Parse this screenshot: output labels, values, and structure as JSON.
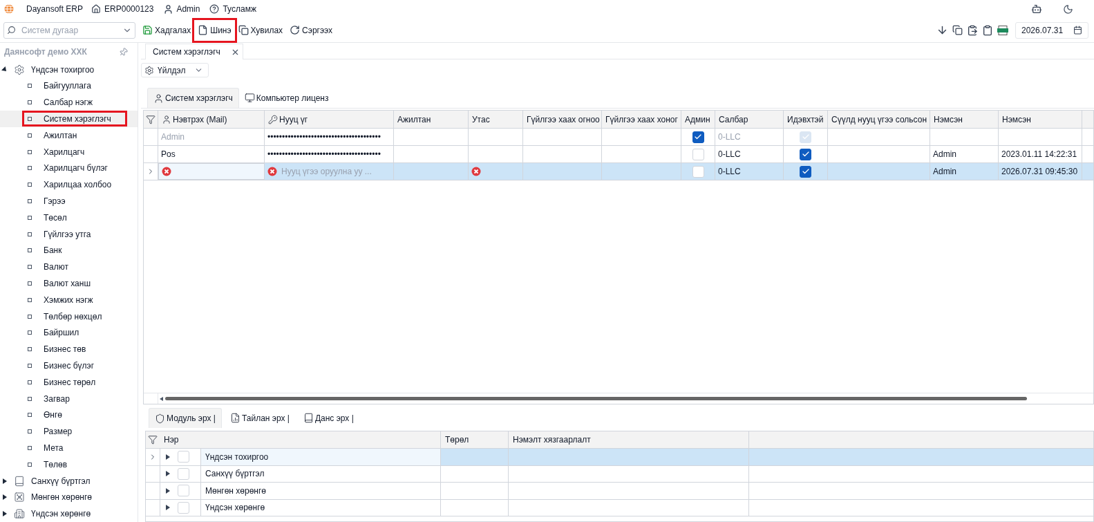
{
  "topbar": {
    "app": "Dayansoft ERP",
    "document": "ERP0000123",
    "user": "Admin",
    "help": "Тусламж"
  },
  "toolbar": {
    "search_placeholder": "Систем дугаар",
    "buttons": [
      {
        "kind": "save",
        "label": "Хадгалах",
        "highlighted": false
      },
      {
        "kind": "new",
        "label": "Шинэ",
        "highlighted": true
      },
      {
        "kind": "copy",
        "label": "Хувилах",
        "highlighted": false
      },
      {
        "kind": "refresh",
        "label": "Сэргээх",
        "highlighted": false
      }
    ],
    "date": "2026.07.31"
  },
  "sidebar": {
    "company": "Даянсофт демо ХХК",
    "items": [
      {
        "kind": "settings",
        "label": "Үндсэн тохиргоо",
        "expanded": true,
        "children": [
          {
            "label": "Байгууллага",
            "selected": false,
            "highlighted": false
          },
          {
            "label": "Салбар нэгж",
            "selected": false,
            "highlighted": false
          },
          {
            "label": "Систем хэрэглэгч",
            "selected": true,
            "highlighted": true
          },
          {
            "label": "Ажилтан",
            "selected": false,
            "highlighted": false
          },
          {
            "label": "Харилцагч",
            "selected": false,
            "highlighted": false
          },
          {
            "label": "Харилцагч бүлэг",
            "selected": false,
            "highlighted": false
          },
          {
            "label": "Харилцаа холбоо",
            "selected": false,
            "highlighted": false
          },
          {
            "label": "Гэрээ",
            "selected": false,
            "highlighted": false
          },
          {
            "label": "Төсөл",
            "selected": false,
            "highlighted": false
          },
          {
            "label": "Гүйлгээ утга",
            "selected": false,
            "highlighted": false
          },
          {
            "label": "Банк",
            "selected": false,
            "highlighted": false
          },
          {
            "label": "Валют",
            "selected": false,
            "highlighted": false
          },
          {
            "label": "Валют ханш",
            "selected": false,
            "highlighted": false
          },
          {
            "label": "Хэмжих нэгж",
            "selected": false,
            "highlighted": false
          },
          {
            "label": "Төлбөр нөхцөл",
            "selected": false,
            "highlighted": false
          },
          {
            "label": "Байршил",
            "selected": false,
            "highlighted": false
          },
          {
            "label": "Бизнес төв",
            "selected": false,
            "highlighted": false
          },
          {
            "label": "Бизнес бүлэг",
            "selected": false,
            "highlighted": false
          },
          {
            "label": "Бизнес төрөл",
            "selected": false,
            "highlighted": false
          },
          {
            "label": "Загвар",
            "selected": false,
            "highlighted": false
          },
          {
            "label": "Өнгө",
            "selected": false,
            "highlighted": false
          },
          {
            "label": "Размер",
            "selected": false,
            "highlighted": false
          },
          {
            "label": "Мета",
            "selected": false,
            "highlighted": false
          },
          {
            "label": "Төлөв",
            "selected": false,
            "highlighted": false
          }
        ]
      },
      {
        "kind": "book",
        "label": "Санхүү бүртгэл",
        "expanded": false
      },
      {
        "kind": "safe",
        "label": "Мөнгөн хөрөнгө",
        "expanded": false
      },
      {
        "kind": "building",
        "label": "Үндсэн хөрөнгө",
        "expanded": false
      }
    ]
  },
  "document_tab": "Систем хэрэглэгч",
  "action_button": "Үйлдэл",
  "tabs": [
    {
      "kind": "user",
      "label": "Систем хэрэглэгч",
      "selected": true
    },
    {
      "kind": "computer",
      "label": "Компьютер лиценз",
      "selected": false
    }
  ],
  "table": {
    "columns": [
      {
        "label": "Нэвтрэх (Mail)",
        "kind": "user"
      },
      {
        "label": "Нууц үг",
        "kind": "key"
      },
      {
        "label": "Ажилтан"
      },
      {
        "label": "Утас"
      },
      {
        "label": "Гүйлгээ хаах огноо"
      },
      {
        "label": "Гүйлгээ хаах хоног"
      },
      {
        "label": "Админ"
      },
      {
        "label": "Салбар"
      },
      {
        "label": "Идэвхтэй"
      },
      {
        "label": "Сүүлд нууц үгээ сольсон"
      },
      {
        "label": "Нэмсэн"
      },
      {
        "label": "Нэмсэн"
      }
    ],
    "rows": [
      {
        "selected": false,
        "disabled": true,
        "login": "Admin",
        "password": "•••••••••••••••••••••••••••••••••••••••",
        "admin": true,
        "branch": "0-LLC",
        "active": true
      },
      {
        "selected": false,
        "disabled": false,
        "login": "Pos",
        "password": "•••••••••••••••••••••••••••••••••••••••",
        "admin": false,
        "branch": "0-LLC",
        "active": true,
        "added_by": "Admin",
        "added_at": "2023.01.11 14:22:31"
      },
      {
        "selected": true,
        "disabled": false,
        "login_error": true,
        "password_error": true,
        "password_placeholder": "Нууц үгээ оруулна уу ...",
        "phone_error": true,
        "admin": false,
        "branch": "0-LLC",
        "active": true,
        "added_by": "Admin",
        "added_at": "2026.07.31 09:45:30"
      }
    ]
  },
  "bottom_tabs": [
    {
      "kind": "shield",
      "label": "Модуль эрх |",
      "selected": true
    },
    {
      "kind": "report",
      "label": "Тайлан эрх |",
      "selected": false
    },
    {
      "kind": "book",
      "label": "Данс эрх |",
      "selected": false
    }
  ],
  "bottom_table": {
    "columns": [
      "Нэр",
      "Төрөл",
      "Нэмэлт хязгаарлалт"
    ],
    "rows": [
      {
        "label": "Үндсэн тохиргоо",
        "checked": false,
        "selected": true
      },
      {
        "label": "Санхүү бүртгэл",
        "checked": false,
        "selected": false
      },
      {
        "label": "Мөнгөн хөрөнгө",
        "checked": false,
        "selected": false
      },
      {
        "label": "Үндсэн хөрөнгө",
        "checked": false,
        "selected": false
      }
    ]
  }
}
